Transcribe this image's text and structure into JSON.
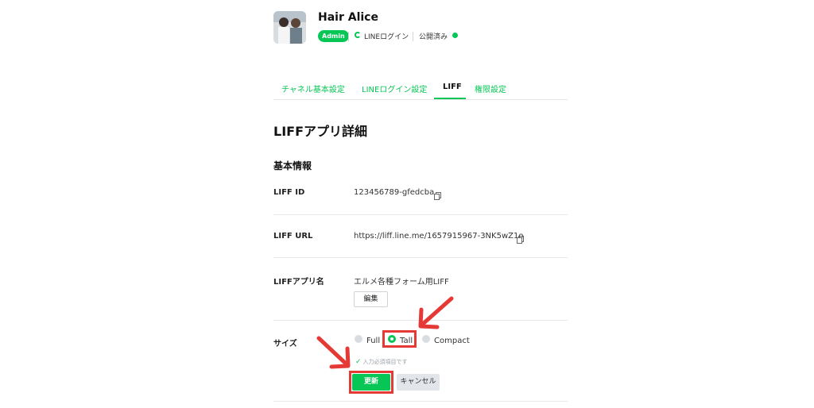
{
  "header": {
    "channel_name": "Hair Alice",
    "role_badge": "Admin",
    "login_label": "LINEログイン",
    "status_label": "公開済み"
  },
  "tabs": [
    {
      "label": "チャネル基本設定",
      "active": false
    },
    {
      "label": "LINEログイン設定",
      "active": false
    },
    {
      "label": "LIFF",
      "active": true
    },
    {
      "label": "権限設定",
      "active": false
    }
  ],
  "page": {
    "title": "LIFFアプリ詳細",
    "section_title": "基本情報"
  },
  "fields": {
    "liff_id": {
      "label": "LIFF ID",
      "value": "123456789-gfedcba"
    },
    "liff_url": {
      "label": "LIFF URL",
      "value": "https://liff.line.me/1657915967-3NK5wZ1o"
    },
    "app_name": {
      "label": "LIFFアプリ名",
      "value": "エルメ各種フォーム用LIFF",
      "edit_label": "編集"
    },
    "size": {
      "label": "サイズ",
      "options": [
        {
          "label": "Full",
          "selected": false
        },
        {
          "label": "Tall",
          "selected": true
        },
        {
          "label": "Compact",
          "selected": false
        }
      ],
      "hint": "入力必須項目です"
    }
  },
  "buttons": {
    "update": "更新",
    "cancel": "キャンセル"
  },
  "colors": {
    "accent": "#06c755",
    "annotation": "#e53935"
  }
}
